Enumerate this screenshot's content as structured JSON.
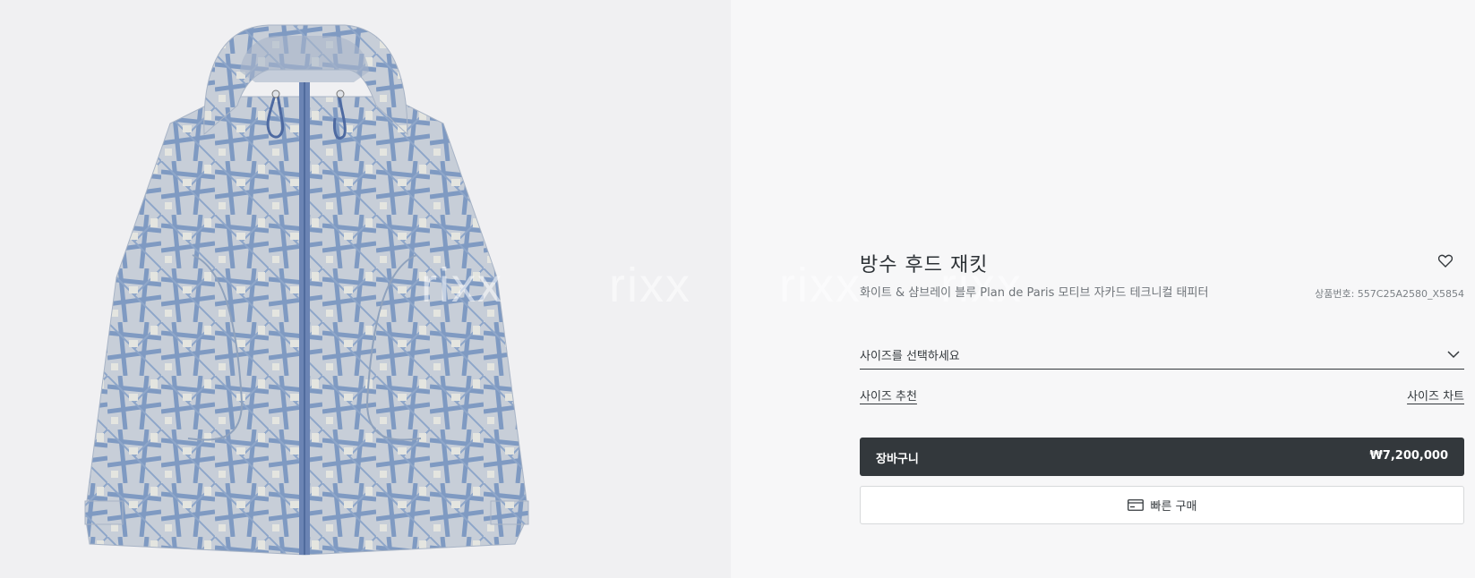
{
  "product": {
    "title": "방수 후드 재킷",
    "subtitle": "화이트 & 샴브레이 블루 Plan de Paris 모티브 자카드 테크니컬 태피터",
    "sku": "상품번호: 557C25A2580_X5854",
    "image_alt": "product-photo-hooded-jacket"
  },
  "size": {
    "placeholder": "사이즈를 선택하세요",
    "recommend_label": "사이즈 추천",
    "chart_label": "사이즈 차트"
  },
  "cart": {
    "label": "장바구니",
    "price": "₩7,200,000"
  },
  "quick_buy": {
    "label": "빠른 구매"
  },
  "watermarks": [
    "rixx",
    "rixx",
    "rixx",
    "rixx"
  ],
  "icons": {
    "wishlist": "heart-icon",
    "dropdown": "chevron-down-icon",
    "quick_buy": "credit-card-icon"
  },
  "colors": {
    "dark_button": "#33383c",
    "jacket_blue": "#7f9ac2",
    "jacket_light": "#c9cfd8"
  }
}
